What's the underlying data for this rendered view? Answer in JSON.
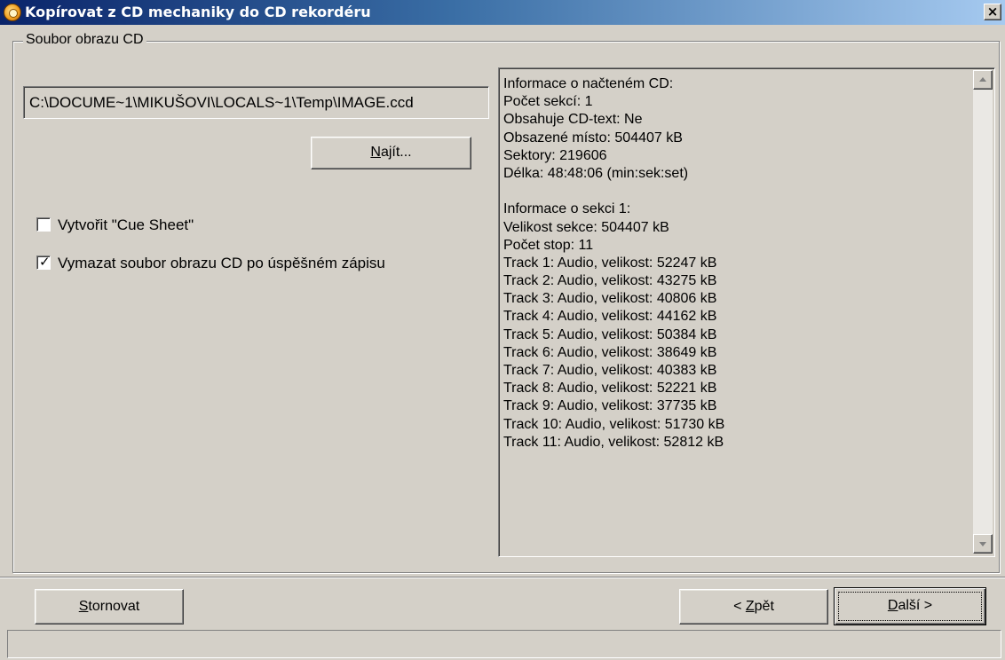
{
  "window": {
    "title": "Kopírovat z CD mechaniky do CD rekordéru",
    "close_label": "×",
    "icon": "nero-disc-icon"
  },
  "group": {
    "label": "Soubor obrazu CD"
  },
  "image_path": {
    "value": "C:\\DOCUME~1\\MIKUŠOVI\\LOCALS~1\\Temp\\IMAGE.ccd"
  },
  "find_button": {
    "label_pre": "",
    "label_accel": "N",
    "label_post": "ajít..."
  },
  "checkboxes": [
    {
      "label": "Vytvořit \"Cue Sheet\"",
      "checked": false
    },
    {
      "label": "Vymazat soubor obrazu CD po úspěšném zápisu",
      "checked": true
    }
  ],
  "info": {
    "lines": [
      "Informace o načteném CD:",
      "Počet sekcí: 1",
      "Obsahuje CD-text: Ne",
      "Obsazené místo: 504407 kB",
      "Sektory: 219606",
      "Délka: 48:48:06 (min:sek:set)",
      "",
      "Informace o sekci 1:",
      "Velikost sekce: 504407 kB",
      "Počet stop: 11",
      "Track 1: Audio, velikost: 52247 kB",
      "Track 2: Audio, velikost: 43275 kB",
      "Track 3: Audio, velikost: 40806 kB",
      "Track 4: Audio, velikost: 44162 kB",
      "Track 5: Audio, velikost: 50384 kB",
      "Track 6: Audio, velikost: 38649 kB",
      "Track 7: Audio, velikost: 40383 kB",
      "Track 8: Audio, velikost: 52221 kB",
      "Track 9: Audio, velikost: 37735 kB",
      "Track 10: Audio, velikost: 51730 kB",
      "Track 11: Audio, velikost: 52812 kB"
    ]
  },
  "buttons": {
    "cancel": {
      "accel": "S",
      "rest": "tornovat"
    },
    "back": {
      "pre": "< ",
      "accel": "Z",
      "rest": "pět"
    },
    "next": {
      "accel": "D",
      "rest": "alší >"
    }
  }
}
